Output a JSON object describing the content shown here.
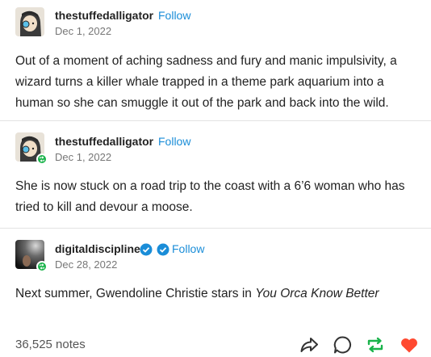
{
  "posts": [
    {
      "username": "thestuffedalligator",
      "follow_label": "Follow",
      "date": "Dec 1, 2022",
      "text": "Out of a moment of aching sadness and fury and manic impulsivity, a wizard turns a killer whale trapped in a theme park aquarium into a human so she can smuggle it out of the park and back into the wild."
    },
    {
      "username": "thestuffedalligator",
      "follow_label": "Follow",
      "date": "Dec 1, 2022",
      "text": "She is now stuck on a road trip to the coast with a 6’6 woman who has tried to kill and devour a moose."
    },
    {
      "username": "digitaldiscipline",
      "follow_label": "Follow",
      "date": "Dec 28, 2022",
      "text_before": "Next summer, Gwendoline Christie stars in ",
      "text_italic": "You Orca Know Better"
    }
  ],
  "footer": {
    "notes": "36,525 notes"
  },
  "icons": {
    "share": "share-icon",
    "reply": "reply-icon",
    "reblog": "reblog-icon",
    "like": "heart-icon"
  },
  "colors": {
    "follow": "#1a8dd8",
    "reblog": "#19b34a",
    "like": "#ff4930",
    "verified": "#1a8dd8"
  }
}
